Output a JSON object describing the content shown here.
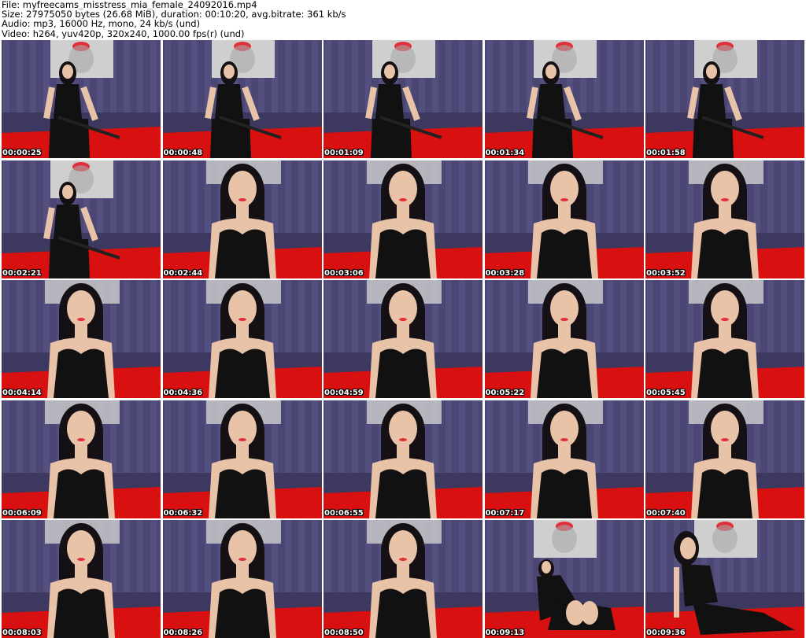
{
  "header": {
    "file_line": "File: myfreecams_misstress_mia_female_24092016.mp4",
    "size_line": "Size: 27975050 bytes (26.68 MiB), duration: 00:10:20, avg.bitrate: 361 kb/s",
    "audio_line": "Audio: mp3, 16000 Hz, mono, 24 kb/s (und)",
    "video_line": "Video: h264, yuv420p, 320x240, 1000.00 fps(r) (und)"
  },
  "colors": {
    "wall_purple": "#4b4674",
    "wall_stripe": "#5b5788",
    "sofa_red": "#d8100f",
    "poster_grey": "#cfcfcf",
    "lips_red": "#e0303a",
    "outfit_black": "#111111",
    "skin": "#e9c3a8",
    "hair": "#141014"
  },
  "thumbnails": [
    {
      "timestamp": "00:00:25",
      "pose": "seated-far"
    },
    {
      "timestamp": "00:00:48",
      "pose": "seated-far"
    },
    {
      "timestamp": "00:01:09",
      "pose": "seated-far"
    },
    {
      "timestamp": "00:01:34",
      "pose": "seated-far"
    },
    {
      "timestamp": "00:01:58",
      "pose": "seated-far"
    },
    {
      "timestamp": "00:02:21",
      "pose": "seated-far"
    },
    {
      "timestamp": "00:02:44",
      "pose": "close"
    },
    {
      "timestamp": "00:03:06",
      "pose": "close"
    },
    {
      "timestamp": "00:03:28",
      "pose": "close"
    },
    {
      "timestamp": "00:03:52",
      "pose": "close"
    },
    {
      "timestamp": "00:04:14",
      "pose": "close"
    },
    {
      "timestamp": "00:04:36",
      "pose": "close"
    },
    {
      "timestamp": "00:04:59",
      "pose": "close"
    },
    {
      "timestamp": "00:05:22",
      "pose": "close"
    },
    {
      "timestamp": "00:05:45",
      "pose": "close"
    },
    {
      "timestamp": "00:06:09",
      "pose": "close"
    },
    {
      "timestamp": "00:06:32",
      "pose": "close"
    },
    {
      "timestamp": "00:06:55",
      "pose": "close"
    },
    {
      "timestamp": "00:07:17",
      "pose": "close"
    },
    {
      "timestamp": "00:07:40",
      "pose": "close"
    },
    {
      "timestamp": "00:08:03",
      "pose": "close"
    },
    {
      "timestamp": "00:08:26",
      "pose": "close"
    },
    {
      "timestamp": "00:08:50",
      "pose": "close"
    },
    {
      "timestamp": "00:09:13",
      "pose": "lying"
    },
    {
      "timestamp": "00:09:36",
      "pose": "reclining"
    }
  ]
}
